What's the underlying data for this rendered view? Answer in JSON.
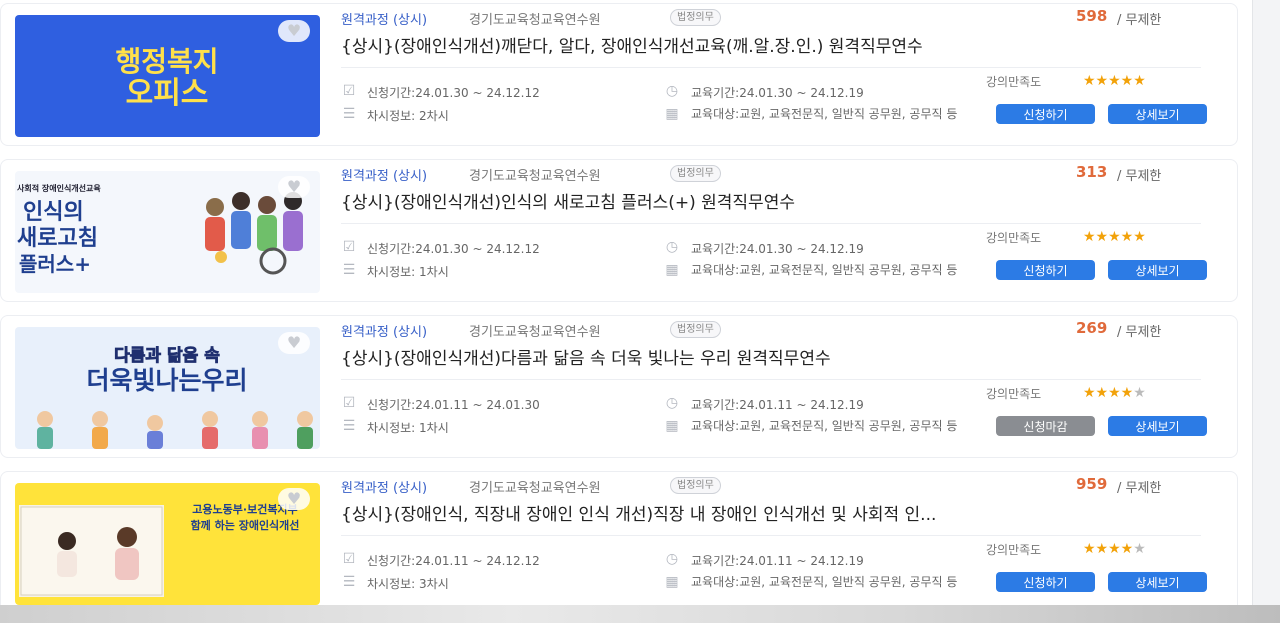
{
  "courses": [
    {
      "category": "원격과정 (상시)",
      "org": "경기도교육청교육연수원",
      "badge": "법정의무",
      "count": "598",
      "limit": "/ 무제한",
      "title": "{상시}(장애인식개선)깨닫다, 알다, 장애인식개선교육(깨.알.장.인.) 원격직무연수",
      "apply_period": "신청기간:24.01.30 ~ 24.12.12",
      "edu_period": "교육기간:24.01.30 ~ 24.12.19",
      "session": "차시정보: 2차시",
      "target": "교육대상:교원, 교육전문직, 일반직 공무원, 공무직 등",
      "satisfaction_label": "강의만족도",
      "rating": 5,
      "apply_button": "신청하기",
      "detail_button": "상세보기",
      "thumb": {
        "line1": "행정복지",
        "line2": "오피스"
      }
    },
    {
      "category": "원격과정 (상시)",
      "org": "경기도교육청교육연수원",
      "badge": "법정의무",
      "count": "313",
      "limit": "/ 무제한",
      "title": "{상시}(장애인식개선)인식의 새로고침 플러스(+) 원격직무연수",
      "apply_period": "신청기간:24.01.30 ~ 24.12.12",
      "edu_period": "교육기간:24.01.30 ~ 24.12.19",
      "session": "차시정보: 1차시",
      "target": "교육대상:교원, 교육전문직, 일반직 공무원, 공무직 등",
      "satisfaction_label": "강의만족도",
      "rating": 5,
      "apply_button": "신청하기",
      "detail_button": "상세보기",
      "thumb": {
        "small": "사회적 장애인식개선교육",
        "line1": "인식의",
        "line2": "새로고침",
        "line3": "플러스+"
      }
    },
    {
      "category": "원격과정 (상시)",
      "org": "경기도교육청교육연수원",
      "badge": "법정의무",
      "count": "269",
      "limit": "/ 무제한",
      "title": "{상시}(장애인식개선)다름과 닮음 속 더욱 빛나는 우리 원격직무연수",
      "apply_period": "신청기간:24.01.11 ~ 24.01.30",
      "edu_period": "교육기간:24.01.11 ~ 24.12.19",
      "session": "차시정보: 1차시",
      "target": "교육대상:교원, 교육전문직, 일반직 공무원, 공무직 등",
      "satisfaction_label": "강의만족도",
      "rating": 4.5,
      "apply_button": "신청마감",
      "detail_button": "상세보기",
      "thumb": {
        "line1": "다름과 닮음 속",
        "line2": "더욱빛나는우리"
      }
    },
    {
      "category": "원격과정 (상시)",
      "org": "경기도교육청교육연수원",
      "badge": "법정의무",
      "count": "959",
      "limit": "/ 무제한",
      "title": "{상시}(장애인식, 직장내 장애인 인식 개선)직장 내 장애인 인식개선 및 사회적 인...",
      "apply_period": "신청기간:24.01.11 ~ 24.12.12",
      "edu_period": "교육기간:24.01.11 ~ 24.12.19",
      "session": "차시정보: 3차시",
      "target": "교육대상:교원, 교육전문직, 일반직 공무원, 공무직 등",
      "satisfaction_label": "강의만족도",
      "rating": 4.5,
      "apply_button": "신청하기",
      "detail_button": "상세보기",
      "thumb": {
        "line1": "고용노동부·보건복지부",
        "line2": "함께 하는 장애인식개선"
      }
    }
  ],
  "colors": {
    "accent": "#2c7be5",
    "count": "#e06a3b",
    "category": "#3860c8",
    "star": "#f2a20a",
    "closed": "#8a8d92"
  }
}
